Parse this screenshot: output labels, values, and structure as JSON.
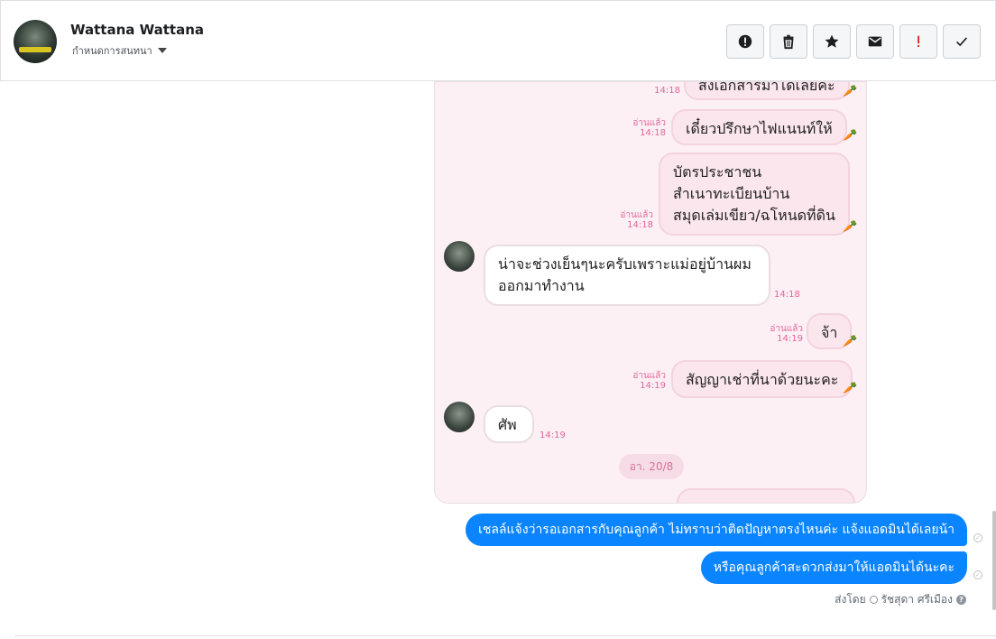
{
  "header": {
    "name": "Wattana Wattana",
    "assign_label": "กำหนดการสนทนา",
    "toolbar": [
      "alert-icon",
      "trash-icon",
      "star-icon",
      "envelope-icon",
      "exclamation-icon",
      "check-icon"
    ]
  },
  "screenshot": {
    "bubbles": [
      {
        "text": "ส่งเอกสารมาได้เลยค่ะ",
        "side": "out",
        "read": "",
        "time": "14:18"
      },
      {
        "text": "เดี๋ยวปรึกษาไฟแนนท์ให้",
        "side": "out",
        "read": "อ่านแล้ว",
        "time": "14:18"
      },
      {
        "line1": "บัตรประชาชน",
        "line2": "สำเนาทะเบียนบ้าน",
        "line3": "สมุดเล่มเขียว/ฉโหนดที่ดิน",
        "side": "out",
        "read": "อ่านแล้ว",
        "time": "14:18"
      },
      {
        "line1": "น่าจะช่วงเย็นๆนะครับเพราะแม่อยู่บ้านผม",
        "line2": "ออกมาทำงาน",
        "side": "in",
        "time": "14:18"
      },
      {
        "text": "จ้า",
        "side": "out",
        "read": "อ่านแล้ว",
        "time": "14:19"
      },
      {
        "text": "สัญญาเช่าที่นาด้วยนะคะ",
        "side": "out",
        "read": "อ่านแล้ว",
        "time": "14:19"
      },
      {
        "text": "ศัพ",
        "side": "in",
        "time": "14:19"
      }
    ],
    "date_pill": "อา. 20/8"
  },
  "messages": [
    {
      "text": "เชลล์แจ้งว่ารอเอกสารกับคุณลูกค้า ไม่ทราบว่าติดปัญหาตรงไหนค่ะ แจ้งแอดมินได้เลยน้า"
    },
    {
      "text": "หรือคุณลูกค้าสะดวกส่งมาให้แอดมินได้นะคะ"
    }
  ],
  "sent_by": {
    "prefix": "ส่งโดย",
    "agent": "รัชสุดา ศรีเมือง"
  }
}
